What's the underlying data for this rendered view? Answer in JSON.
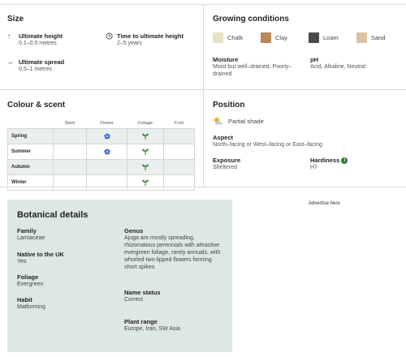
{
  "size": {
    "title": "Size",
    "ultimate_height_label": "Ultimate height",
    "ultimate_height_value": "0.1–0.5 metres",
    "time_label": "Time to ultimate height",
    "time_value": "2–5 years",
    "spread_label": "Ultimate spread",
    "spread_value": "0.5–1 metres",
    "icons": [
      "height-arrow-icon",
      "clock-icon",
      "spread-arrow-icon"
    ]
  },
  "growing": {
    "title": "Growing conditions",
    "soils": [
      {
        "name": "Chalk",
        "color": "#e6e2c6"
      },
      {
        "name": "Clay",
        "color": "#b9875a"
      },
      {
        "name": "Loam",
        "color": "#4a4a4a"
      },
      {
        "name": "Sand",
        "color": "#d9c3a3"
      }
    ],
    "moisture_label": "Moisture",
    "moisture_value": "Moist but well–drained, Poorly–drained",
    "ph_label": "pH",
    "ph_value": "Acid, Alkaline, Neutral"
  },
  "colour": {
    "title": "Colour & scent",
    "columns": [
      "Stem",
      "Flower",
      "Foliage",
      "Fruit"
    ],
    "rows": [
      {
        "season": "Spring",
        "flower": true,
        "foliage": true
      },
      {
        "season": "Summer",
        "flower": true,
        "foliage": true
      },
      {
        "season": "Autumn",
        "flower": false,
        "foliage": true
      },
      {
        "season": "Winter",
        "flower": false,
        "foliage": true
      }
    ],
    "flower_color": "#3a6fd8",
    "foliage_color": "#2e7d32"
  },
  "position": {
    "title": "Position",
    "sun": "Partial shade",
    "aspect_label": "Aspect",
    "aspect_value": "North–facing or West–facing or East–facing",
    "exposure_label": "Exposure",
    "exposure_value": "Sheltered",
    "hardiness_label": "Hardiness",
    "hardiness_value": "H7",
    "info_glyph": "i"
  },
  "botanical": {
    "title": "Botanical details",
    "family_label": "Family",
    "family_value": "Lamiaceae",
    "native_label": "Native to the UK",
    "native_value": "Yes",
    "foliage_label": "Foliage",
    "foliage_value": "Evergreen",
    "habit_label": "Habit",
    "habit_value": "Matforming",
    "genus_label": "Genus",
    "genus_value": "Ajuga are mostly spreading, rhizomatous perennials with attractive evergreen foliage, rarely annuals, with whorled two-lipped flowers forming short spikes",
    "name_status_label": "Name status",
    "name_status_value": "Correct",
    "range_label": "Plant range",
    "range_value": "Europe, Iran, SW Asia"
  },
  "advert": "Advertise here"
}
